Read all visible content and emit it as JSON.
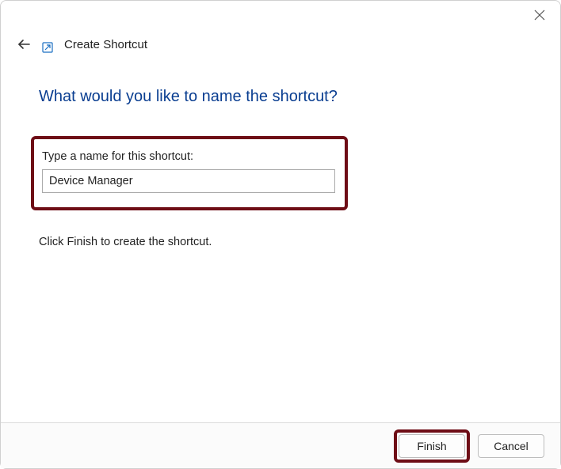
{
  "window": {
    "wizard_title": "Create Shortcut"
  },
  "content": {
    "heading": "What would you like to name the shortcut?",
    "field_label": "Type a name for this shortcut:",
    "shortcut_name_value": "Device Manager",
    "instruction": "Click Finish to create the shortcut."
  },
  "buttons": {
    "finish": "Finish",
    "cancel": "Cancel"
  },
  "annotation": {
    "highlight_color": "#6e0d16",
    "arrow_points_to": "finish"
  }
}
